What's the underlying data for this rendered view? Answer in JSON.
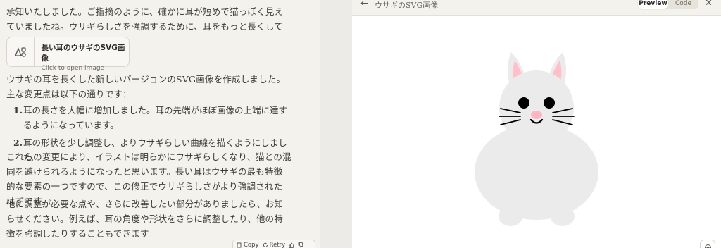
{
  "chat": {
    "intro": "承知いたしました。ご指摘のように、確かに耳が短めで猫っぽく見えていましたね。ウサギらしさを強調するために、耳をもっと長くしてみましょう。",
    "artifact": {
      "title": "長い耳のウサギのSVG画像",
      "subtitle": "Click to open image",
      "icon": "shapes-icon"
    },
    "summary": "ウサギの耳を長くした新しいバージョンのSVG画像を作成しました。主な変更点は以下の通りです：",
    "changes": [
      {
        "num": "1.",
        "text": "耳の長さを大幅に増加しました。耳の先端がほぼ画像の上端に達するようになっています。"
      },
      {
        "num": "2.",
        "text": "耳の形状を少し調整し、よりウサギらしい曲線を描くようにしました。"
      }
    ],
    "result": "これらの変更により、イラストは明らかにウサギらしくなり、猫との混同を避けられるようになったと思います。長い耳はウサギの最も特徴的な要素の一つですので、この修正でウサギらしさがより強調されたはずです。",
    "closing": "他に調整が必要な点や、さらに改善したい部分がありましたら、お知らせください。例えば、耳の角度や形状をさらに調整したり、他の特徴を強調したりすることもできます。",
    "actions": {
      "copy": "Copy",
      "retry": "Retry"
    }
  },
  "preview": {
    "title": "ウサギのSVG画像",
    "tab_preview": "Preview",
    "tab_code": "Code",
    "colors": {
      "body": "#ebebeb",
      "inner_ear": "#ffc0cb",
      "eyes": "#000000",
      "nose": "#ffb6c1"
    }
  }
}
